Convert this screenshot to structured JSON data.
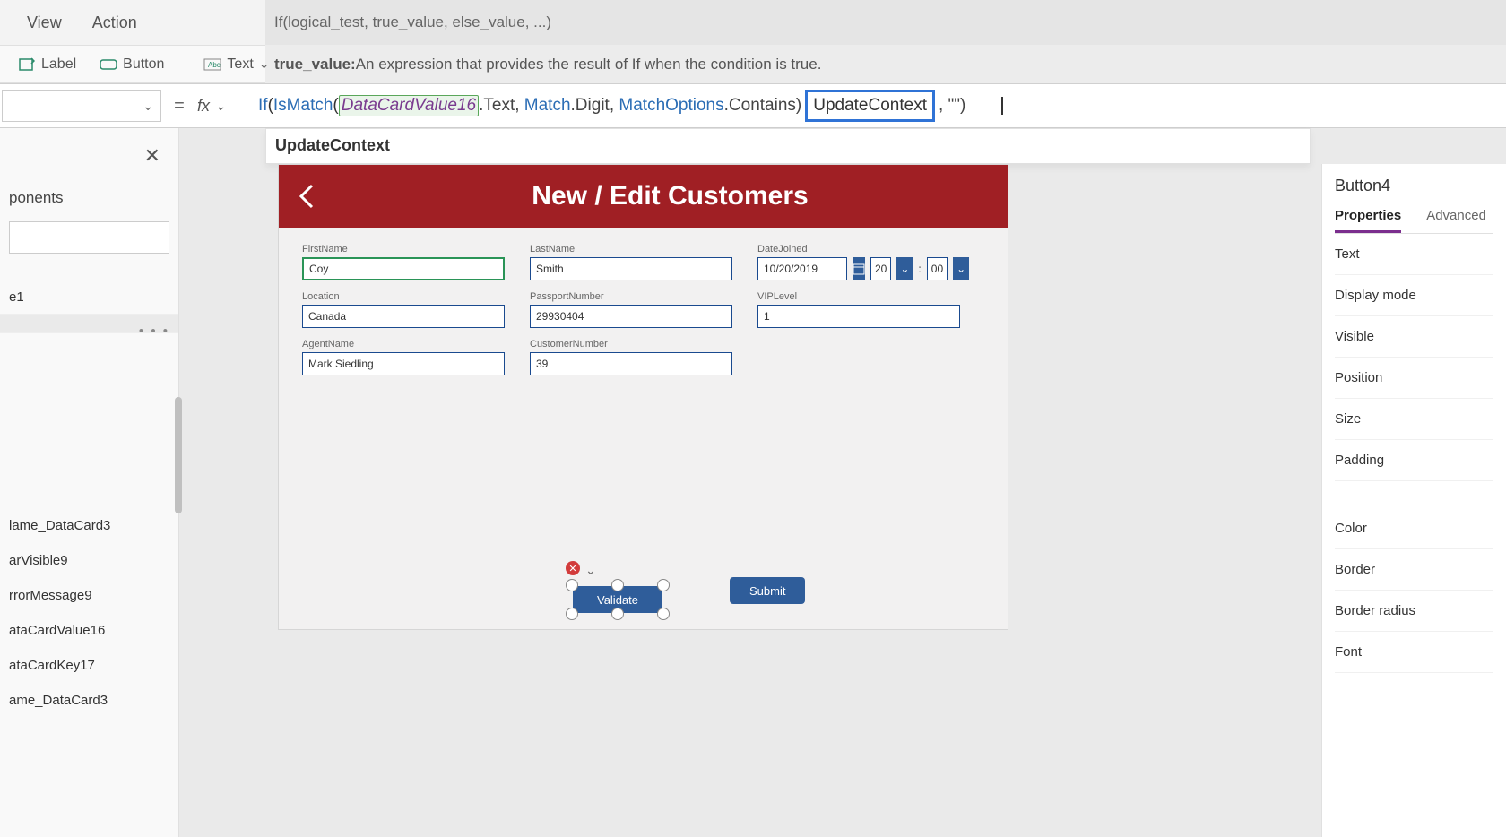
{
  "menubar": {
    "view": "View",
    "action": "Action"
  },
  "ribbon": {
    "label": "Label",
    "button": "Button",
    "text": "Text"
  },
  "hint_signature": "If(logical_test, true_value, else_value, ...)",
  "hint_desc_label": "true_value:",
  "hint_desc_text": " An expression that provides the result of If when the condition is true.",
  "intellisense": "UpdateContext",
  "formula": {
    "if": "If",
    "open": "(",
    "ismatch": "IsMatch",
    "open2": "(",
    "var": "DataCardValue16",
    "dot_text": ".Text, ",
    "match": "Match",
    "dot_digit": ".Digit, ",
    "matchopt": "MatchOptions",
    "dot_contains": ".Contains)",
    "highlight": "UpdateContext",
    "tail": ", \"\")"
  },
  "left": {
    "header": "ponents",
    "item1": "e1",
    "tree": [
      "lame_DataCard3",
      "arVisible9",
      "rrorMessage9",
      "ataCardValue16",
      "ataCardKey17",
      "ame_DataCard3"
    ]
  },
  "app": {
    "title": "New / Edit Customers",
    "fields": {
      "firstname_l": "FirstName",
      "firstname_v": "Coy",
      "lastname_l": "LastName",
      "lastname_v": "Smith",
      "datejoined_l": "DateJoined",
      "datejoined_v": "10/20/2019",
      "hour": "20",
      "min": "00",
      "location_l": "Location",
      "location_v": "Canada",
      "passport_l": "PassportNumber",
      "passport_v": "29930404",
      "vip_l": "VIPLevel",
      "vip_v": "1",
      "agent_l": "AgentName",
      "agent_v": "Mark Siedling",
      "custno_l": "CustomerNumber",
      "custno_v": "39"
    },
    "validate": "Validate",
    "submit": "Submit"
  },
  "right": {
    "selected": "Button4",
    "tab_props": "Properties",
    "tab_adv": "Advanced",
    "rows": [
      "Text",
      "Display mode",
      "Visible",
      "Position",
      "Size",
      "Padding",
      "Color",
      "Border",
      "Border radius",
      "Font"
    ]
  }
}
